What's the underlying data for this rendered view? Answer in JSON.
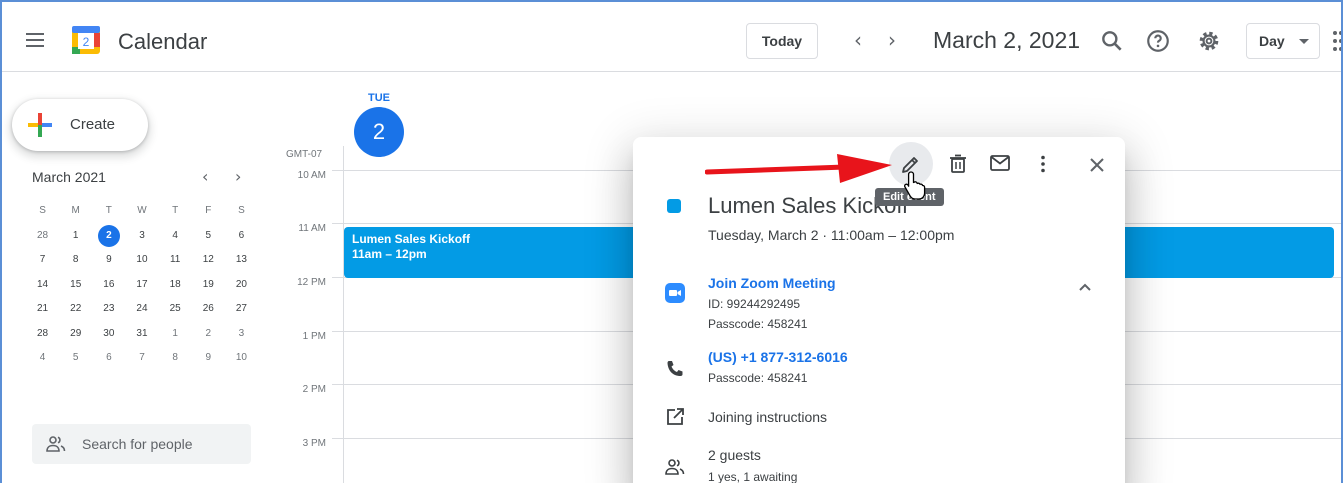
{
  "header": {
    "logo_day": "2",
    "app_title": "Calendar",
    "today_label": "Today",
    "prev_label": "‹",
    "next_label": "›",
    "date_title": "March 2, 2021",
    "view_label": "Day"
  },
  "sidebar": {
    "create_label": "Create",
    "mini_month": "March 2021",
    "mini_prev": "‹",
    "mini_next": "›",
    "dow": [
      "S",
      "M",
      "T",
      "W",
      "T",
      "F",
      "S"
    ],
    "weeks": [
      [
        "28",
        "1",
        "2",
        "3",
        "4",
        "5",
        "6"
      ],
      [
        "7",
        "8",
        "9",
        "10",
        "11",
        "12",
        "13"
      ],
      [
        "14",
        "15",
        "16",
        "17",
        "18",
        "19",
        "20"
      ],
      [
        "21",
        "22",
        "23",
        "24",
        "25",
        "26",
        "27"
      ],
      [
        "28",
        "29",
        "30",
        "31",
        "1",
        "2",
        "3"
      ],
      [
        "4",
        "5",
        "6",
        "7",
        "8",
        "9",
        "10"
      ]
    ],
    "search_people_placeholder": "Search for people"
  },
  "day_view": {
    "dow": "TUE",
    "day_number": "2",
    "timezone": "GMT-07",
    "hours": [
      "10 AM",
      "11 AM",
      "12 PM",
      "1 PM",
      "2 PM",
      "3 PM"
    ],
    "event": {
      "title": "Lumen Sales Kickoff",
      "time": "11am – 12pm"
    }
  },
  "popup": {
    "tooltip": "Edit event",
    "title": "Lumen Sales Kickoff",
    "datetime": "Tuesday, March 2  ·  11:00am – 12:00pm",
    "zoom_link": "Join Zoom Meeting",
    "zoom_id": "ID: 99244292495",
    "zoom_passcode": "Passcode: 458241",
    "phone_link": "(US) +1 877-312-6016",
    "phone_passcode": "Passcode: 458241",
    "joining_instructions": "Joining instructions",
    "guests": "2 guests",
    "guests_status": "1 yes, 1 awaiting"
  },
  "colors": {
    "accent": "#1a73e8",
    "event": "#039be5",
    "arrow": "#e8141b"
  }
}
